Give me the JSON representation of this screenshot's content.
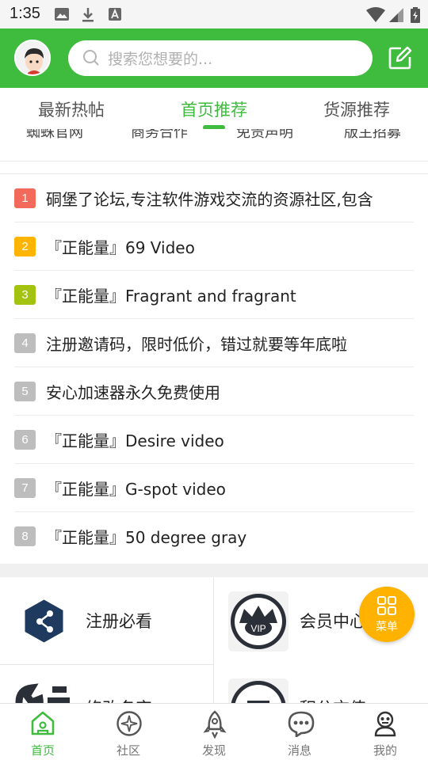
{
  "status_bar": {
    "time": "1:35"
  },
  "header": {
    "search_placeholder": "搜索您想要的...",
    "brand_color": "#3fbb3d"
  },
  "tabs": [
    {
      "label": "最新热帖",
      "active": false
    },
    {
      "label": "首页推荐",
      "active": true
    },
    {
      "label": "货源推荐",
      "active": false
    }
  ],
  "cut_off_links": [
    "蜘蛛官网",
    "商务合作",
    "免责声明",
    "版主招募"
  ],
  "hot_posts": [
    {
      "rank": "1",
      "title": "硐堡了论坛,专注软件游戏交流的资源社区,包含",
      "color": "#f46a5a"
    },
    {
      "rank": "2",
      "title": "『正能量』69 Video",
      "color": "#ffb400"
    },
    {
      "rank": "3",
      "title": "『正能量』Fragrant and fragrant",
      "color": "#a4c210"
    },
    {
      "rank": "4",
      "title": "注册邀请码，限时低价，错过就要等年底啦",
      "color": "#bdbdbd"
    },
    {
      "rank": "5",
      "title": "安心加速器永久免费使用",
      "color": "#bdbdbd"
    },
    {
      "rank": "6",
      "title": "『正能量』Desire video",
      "color": "#bdbdbd"
    },
    {
      "rank": "7",
      "title": "『正能量』G-spot video",
      "color": "#bdbdbd"
    },
    {
      "rank": "8",
      "title": "『正能量』50 degree gray",
      "color": "#bdbdbd"
    }
  ],
  "grid": [
    {
      "label": "注册必看",
      "icon": "share-hexagon-icon"
    },
    {
      "label": "会员中心",
      "icon": "vip-crown-icon"
    },
    {
      "label": "修改名字",
      "icon": "wrench-icon"
    },
    {
      "label": "积分充值",
      "icon": "recharge-icon"
    }
  ],
  "fab": {
    "label": "菜单",
    "color": "#ffb300"
  },
  "bottom_nav": [
    {
      "label": "首页",
      "icon": "home-icon",
      "active": true
    },
    {
      "label": "社区",
      "icon": "community-icon",
      "active": false
    },
    {
      "label": "发现",
      "icon": "rocket-icon",
      "active": false
    },
    {
      "label": "消息",
      "icon": "chat-icon",
      "active": false
    },
    {
      "label": "我的",
      "icon": "profile-icon",
      "active": false
    }
  ]
}
